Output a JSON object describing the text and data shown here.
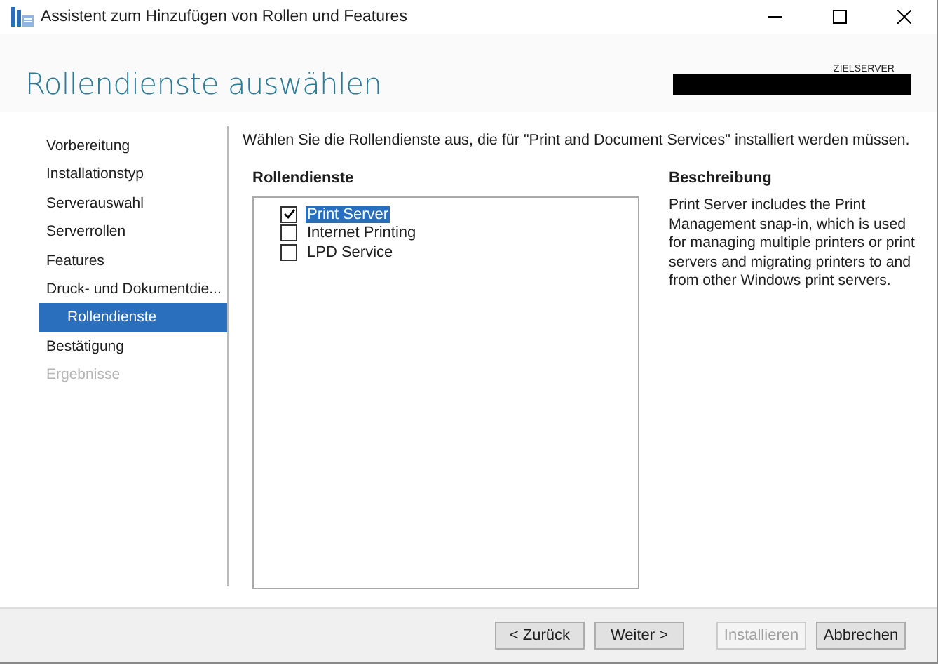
{
  "window": {
    "title": "Assistent zum Hinzufügen von Rollen und Features"
  },
  "header": {
    "title": "Rollendienste auswählen",
    "server_label": "ZIELSERVER"
  },
  "steps": [
    {
      "label": "Vorbereitung",
      "selected": false,
      "disabled": false,
      "sub": false
    },
    {
      "label": "Installationstyp",
      "selected": false,
      "disabled": false,
      "sub": false
    },
    {
      "label": "Serverauswahl",
      "selected": false,
      "disabled": false,
      "sub": false
    },
    {
      "label": "Serverrollen",
      "selected": false,
      "disabled": false,
      "sub": false
    },
    {
      "label": "Features",
      "selected": false,
      "disabled": false,
      "sub": false
    },
    {
      "label": "Druck- und Dokumentdie...",
      "selected": false,
      "disabled": false,
      "sub": false
    },
    {
      "label": "Rollendienste",
      "selected": true,
      "disabled": false,
      "sub": true
    },
    {
      "label": "Bestätigung",
      "selected": false,
      "disabled": false,
      "sub": false
    },
    {
      "label": "Ergebnisse",
      "selected": false,
      "disabled": true,
      "sub": false
    }
  ],
  "intro": "Wählen Sie die Rollendienste aus, die für \"Print and Document Services\" installiert werden müssen.",
  "services": {
    "heading": "Rollendienste",
    "items": [
      {
        "label": "Print Server",
        "checked": true,
        "selected": true
      },
      {
        "label": "Internet Printing",
        "checked": false,
        "selected": false
      },
      {
        "label": "LPD Service",
        "checked": false,
        "selected": false
      }
    ]
  },
  "description": {
    "heading": "Beschreibung",
    "text": "Print Server includes the Print Management snap-in, which is used for managing multiple printers or print servers and migrating printers to and from other Windows print servers."
  },
  "buttons": [
    {
      "label": "< Zurück",
      "disabled": false
    },
    {
      "label": "Weiter >",
      "disabled": false
    },
    {
      "label": "Installieren",
      "disabled": true
    },
    {
      "label": "Abbrechen",
      "disabled": false
    }
  ]
}
